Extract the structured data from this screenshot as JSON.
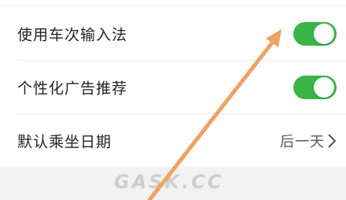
{
  "settings": {
    "items": [
      {
        "label": "使用车次输入法",
        "control": "toggle",
        "enabled": true
      },
      {
        "label": "个性化广告推荐",
        "control": "toggle",
        "enabled": true
      },
      {
        "label": "默认乘坐日期",
        "control": "select",
        "value": "后一天"
      }
    ]
  },
  "watermark": {
    "text": "GASK.CC"
  },
  "colors": {
    "toggle_on": "#3bb54a",
    "annotation_arrow": "#f0a261",
    "footer_bg": "#f2f2f2"
  },
  "icons": {
    "chevron": "chevron-right-icon",
    "annotation": "arrow-annotation-icon"
  }
}
